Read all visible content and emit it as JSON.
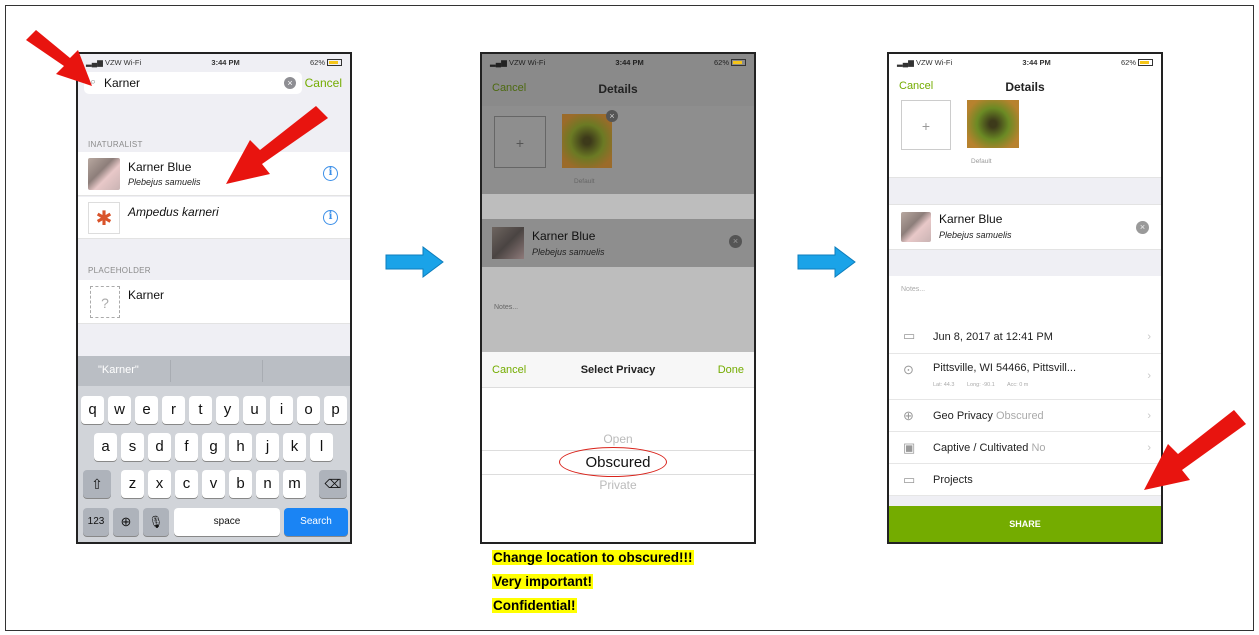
{
  "screen1": {
    "status": {
      "carrier": "VZW Wi-Fi",
      "time": "3:44 PM",
      "battery": "62%"
    },
    "search_value": "Karner",
    "cancel_label": "Cancel",
    "section_naturalist": "INATURALIST",
    "results": [
      {
        "name": "Karner Blue",
        "sci": "Plebejus samuelis"
      },
      {
        "name": "Ampedus karneri",
        "sci": ""
      }
    ],
    "section_placeholder": "PLACEHOLDER",
    "placeholder_item": "Karner",
    "suggestion": "\"Karner\"",
    "keyboard": {
      "row1": [
        "q",
        "w",
        "e",
        "r",
        "t",
        "y",
        "u",
        "i",
        "o",
        "p"
      ],
      "row2": [
        "a",
        "s",
        "d",
        "f",
        "g",
        "h",
        "j",
        "k",
        "l"
      ],
      "row3": [
        "z",
        "x",
        "c",
        "v",
        "b",
        "n",
        "m"
      ],
      "numbers_key": "123",
      "space_key": "space",
      "search_key": "Search"
    }
  },
  "screen2": {
    "status": {
      "carrier": "VZW Wi-Fi",
      "time": "3:44 PM",
      "battery": "62%"
    },
    "nav_cancel": "Cancel",
    "nav_title": "Details",
    "add_photo": "+",
    "default_label": "Default",
    "taxon_name": "Karner Blue",
    "taxon_sci": "Plebejus samuelis",
    "notes_placeholder": "Notes...",
    "picker": {
      "cancel": "Cancel",
      "title": "Select Privacy",
      "done": "Done",
      "options": [
        "Open",
        "Obscured",
        "Private"
      ],
      "selected": "Obscured"
    }
  },
  "screen3": {
    "status": {
      "carrier": "VZW Wi-Fi",
      "time": "3:44 PM",
      "battery": "62%"
    },
    "nav_cancel": "Cancel",
    "nav_title": "Details",
    "add_photo": "+",
    "default_label": "Default",
    "taxon_name": "Karner Blue",
    "taxon_sci": "Plebejus samuelis",
    "notes_placeholder": "Notes...",
    "date": "Jun 8, 2017 at 12:41 PM",
    "location": "Pittsville, WI 54466, Pittsvill...",
    "coords": {
      "lat": "Lat: 44.3",
      "lng": "Long: -90.1",
      "acc": "Acc: 0 m"
    },
    "geo_privacy_label": "Geo Privacy",
    "geo_privacy_value": "Obscured",
    "captive_label": "Captive / Cultivated",
    "captive_value": "No",
    "projects_label": "Projects",
    "share_label": "SHARE"
  },
  "notes": [
    "Change location to obscured!!!",
    "Very important!",
    "Confidential!"
  ],
  "colors": {
    "accent_green": "#74ac00",
    "arrow_blue": "#1aa3e8",
    "arrow_red": "#e8140f",
    "highlight": "#ffff00",
    "search_blue": "#1a84f4"
  }
}
